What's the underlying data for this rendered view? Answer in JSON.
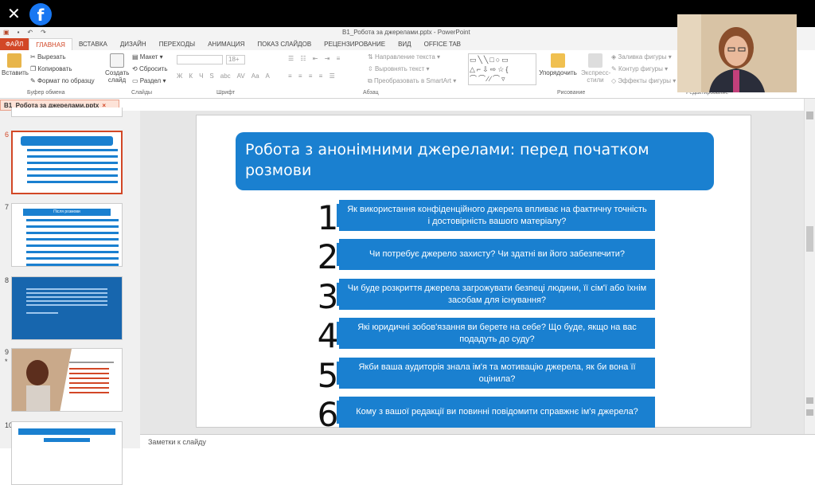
{
  "topbar": {
    "close_icon": "close-icon",
    "fb_icon": "facebook-icon",
    "fb_glyph": "f"
  },
  "window": {
    "title": "B1_Робота за джерелами.pptx - PowerPoint"
  },
  "tabs": [
    "ФАЙЛ",
    "ГЛАВНАЯ",
    "ВСТАВКА",
    "ДИЗАЙН",
    "ПЕРЕХОДЫ",
    "АНИМАЦИЯ",
    "ПОКАЗ СЛАЙДОВ",
    "РЕЦЕНЗИРОВАНИЕ",
    "ВИД",
    "OFFICE TAB"
  ],
  "ribbon": {
    "clipboard": {
      "paste": "Вставить",
      "cut": "Вырезать",
      "copy": "Копировать",
      "format": "Формат по образцу",
      "label": "Буфер обмена"
    },
    "slides": {
      "create": "Создать",
      "create2": "слайд",
      "layout": "Макет",
      "reset": "Сбросить",
      "section": "Раздел",
      "label": "Слайды"
    },
    "font": {
      "size": "18+",
      "label": "Шрифт",
      "buttons": [
        "Ж",
        "К",
        "Ч",
        "S",
        "abc",
        "AV",
        "Aa",
        "A"
      ]
    },
    "paragraph": {
      "text_dir": "Направление текста",
      "align": "Выровнять текст",
      "smartart": "Преобразовать в SmartArt",
      "label": "Абзац"
    },
    "drawing": {
      "arrange": "Упорядочить",
      "styles": "Экспресс-",
      "styles2": "стили",
      "fill": "Заливка фигуры",
      "outline": "Контур фигуры",
      "effects": "Эффекты фигуры",
      "label": "Рисование"
    },
    "editing": {
      "label": "Редактирование"
    }
  },
  "doc_tab": {
    "name": "B1_Робота за джерелами.pptx",
    "close": "×"
  },
  "thumbnails": [
    {
      "num": "6",
      "star": ""
    },
    {
      "num": "7",
      "star": "",
      "title": "Після розмови"
    },
    {
      "num": "8",
      "star": ""
    },
    {
      "num": "9",
      "star": "*"
    },
    {
      "num": "10",
      "star": ""
    }
  ],
  "slide": {
    "title": "Робота з анонімними джерелами: перед початком розмови",
    "items": [
      {
        "n": "1",
        "text": "Як використання конфіденційного джерела впливає на фактичну точність і достовірність вашого матеріалу?"
      },
      {
        "n": "2",
        "text": "Чи потребує джерело захисту? Чи здатні ви його забезпечити?"
      },
      {
        "n": "3",
        "text": "Чи буде розкриття джерела загрожувати безпеці людини, її сім'ї або їхнім засобам для існування?"
      },
      {
        "n": "4",
        "text": "Які юридичні зобов'язання ви берете на себе? Що буде, якщо на вас подадуть до суду?"
      },
      {
        "n": "5",
        "text": "Якби ваша аудиторія знала ім'я та мотивацію джерела, як би вона її оцінила?"
      },
      {
        "n": "6",
        "text": "Кому з вашої редакції ви повинні повідомити справжнє ім'я джерела?"
      }
    ]
  },
  "notes": {
    "placeholder": "Заметки к слайду"
  },
  "colors": {
    "accent": "#d24726",
    "slide_blue": "#1a80d0"
  }
}
